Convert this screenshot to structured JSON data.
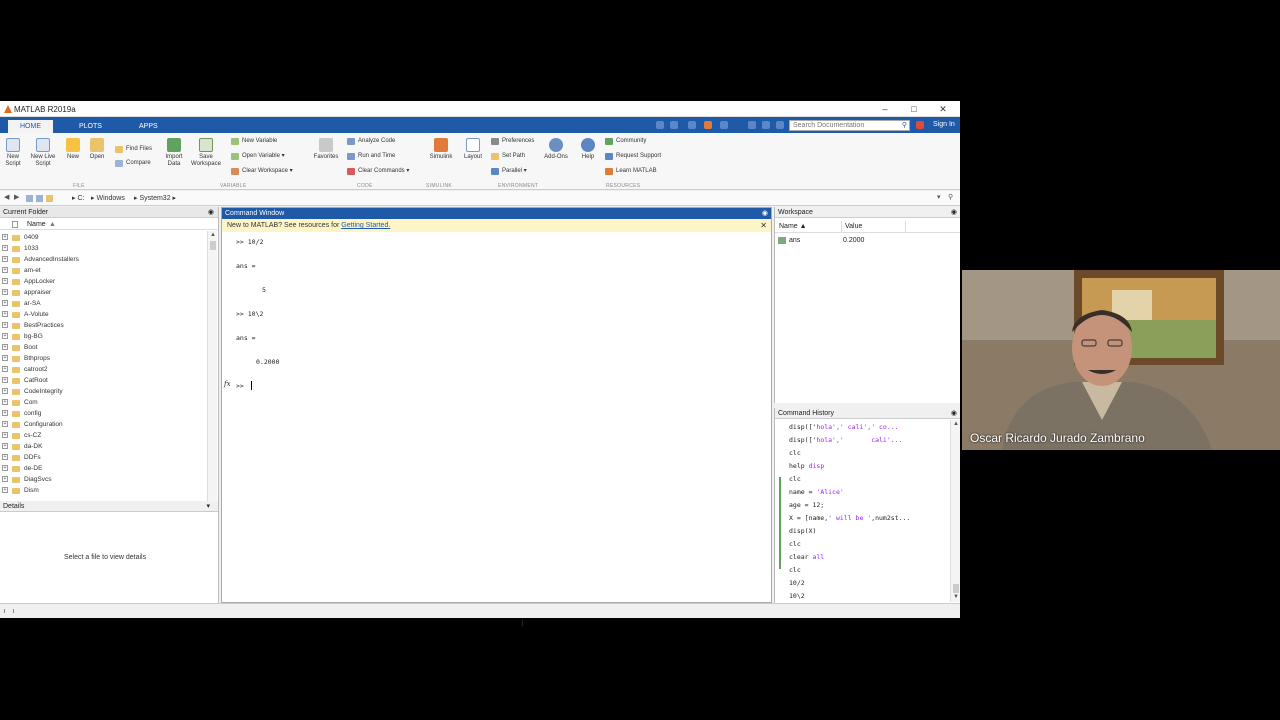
{
  "window": {
    "title": "MATLAB R2019a"
  },
  "tabs": [
    {
      "label": "HOME"
    },
    {
      "label": "PLOTS"
    },
    {
      "label": "APPS"
    }
  ],
  "search": {
    "placeholder": "Search Documentation"
  },
  "signin": {
    "label": "Sign In"
  },
  "ribbon": {
    "new_script": "New Script",
    "new_live_script": "New Live Script",
    "new": "New",
    "open": "Open",
    "find_files": "Find Files",
    "compare": "Compare",
    "import_data": "Import Data",
    "save_workspace": "Save Workspace",
    "new_variable": "New Variable",
    "open_variable": "Open Variable",
    "clear_workspace": "Clear Workspace",
    "favorites": "Favorites",
    "analyze_code": "Analyze Code",
    "run_and_time": "Run and Time",
    "clear_commands": "Clear Commands",
    "simulink": "Simulink",
    "layout": "Layout",
    "preferences": "Preferences",
    "set_path": "Set Path",
    "parallel": "Parallel",
    "add_ons": "Add-Ons",
    "help": "Help",
    "community": "Community",
    "request_support": "Request Support",
    "learn_matlab": "Learn MATLAB",
    "groups": {
      "file": "FILE",
      "variable": "VARIABLE",
      "code": "CODE",
      "simulink": "SIMULINK",
      "environment": "ENVIRONMENT",
      "resources": "RESOURCES"
    }
  },
  "address": {
    "drive": "C:",
    "path1": "Windows",
    "path2": "System32"
  },
  "current_folder": {
    "title": "Current Folder",
    "column": "Name",
    "items": [
      "0409",
      "1033",
      "AdvancedInstallers",
      "am-et",
      "AppLocker",
      "appraiser",
      "ar-SA",
      "A-Volute",
      "BestPractices",
      "bg-BG",
      "Boot",
      "Bthprops",
      "catroot2",
      "CatRoot",
      "CodeIntegrity",
      "Com",
      "config",
      "Configuration",
      "cs-CZ",
      "da-DK",
      "DDFs",
      "de-DE",
      "DiagSvcs",
      "Dism"
    ]
  },
  "details": {
    "title": "Details",
    "empty_text": "Select a file to view details"
  },
  "command_window": {
    "title": "Command Window",
    "banner_text": "New to MATLAB? See resources for ",
    "banner_link": "Getting Started.",
    "lines": [
      ">> 10/2",
      "ans =",
      "5",
      ">> 10\\2",
      "ans =",
      "0.2000"
    ],
    "prompt": ">>",
    "fx": "fx"
  },
  "workspace": {
    "title": "Workspace",
    "col_name": "Name",
    "col_value": "Value",
    "var_name": "ans",
    "var_value": "0.2000"
  },
  "history": {
    "title": "Command History",
    "line1_a": "disp(['",
    "line1_b": "hola',' cali',' co...",
    "line2_a": "disp(['",
    "line2_b": "hola','       cali'...",
    "line3": "clc",
    "line4_a": "help ",
    "line4_b": "disp",
    "line5": "clc",
    "line6_a": "name = ",
    "line6_b": "'Alice'",
    "line7": "age = 12;",
    "line8_a": "X = [name,",
    "line8_b": "' will be '",
    "line8_c": ",num2st...",
    "line9": "disp(X)",
    "line10": "clc",
    "line11_a": "clear ",
    "line11_b": "all",
    "line12": "clc",
    "line13": "10/2",
    "line14": "10\\2"
  },
  "webcam": {
    "name": "Oscar Ricardo Jurado Zambrano"
  }
}
